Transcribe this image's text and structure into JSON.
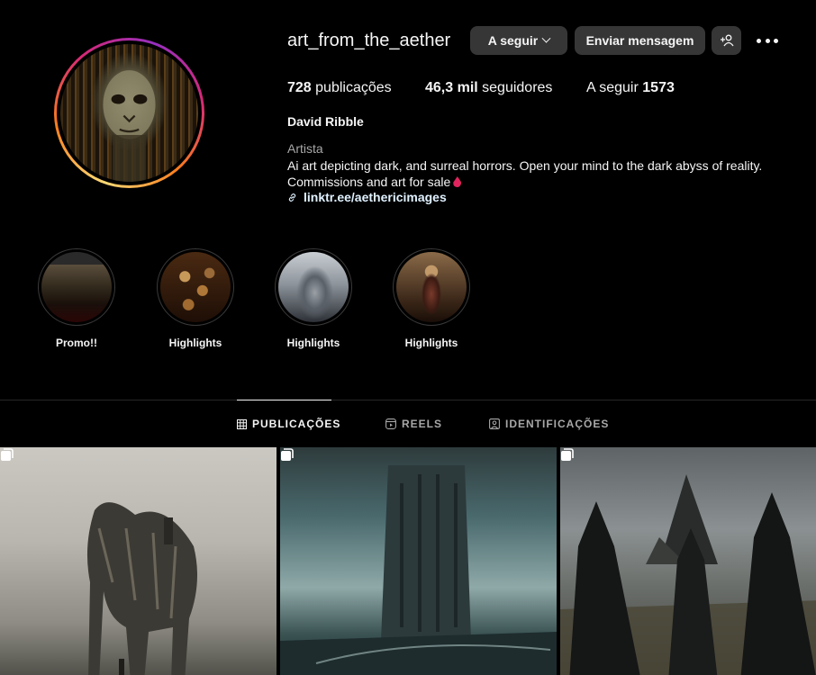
{
  "profile": {
    "username": "art_from_the_aether",
    "follow_button": "A seguir",
    "message_button": "Enviar mensagem",
    "stats": {
      "posts_count": "728",
      "posts_label": " publicações",
      "followers_count": "46,3 mil",
      "followers_label": " seguidores",
      "following_label": "A seguir ",
      "following_count": "1573"
    },
    "full_name": "David Ribble",
    "category": "Artista",
    "bio_line1": "Ai art depicting dark, and surreal horrors. Open your mind to the dark abyss of reality.",
    "bio_line2": "Commissions and art for sale",
    "link": "linktr.ee/aethericimages"
  },
  "highlights": [
    {
      "label": "Promo!!"
    },
    {
      "label": "Highlights"
    },
    {
      "label": "Highlights"
    },
    {
      "label": "Highlights"
    }
  ],
  "tabs": [
    {
      "label": "PUBLICAÇÕES",
      "icon": "grid-icon",
      "active": true
    },
    {
      "label": "REELS",
      "icon": "reels-icon",
      "active": false
    },
    {
      "label": "IDENTIFICAÇÕES",
      "icon": "tagged-icon",
      "active": false
    }
  ],
  "posts": [
    {
      "description_icon": "carousel-icon",
      "multiple": true
    },
    {
      "description_icon": "carousel-icon",
      "multiple": true
    },
    {
      "description_icon": "carousel-icon",
      "multiple": true
    }
  ],
  "colors": {
    "background": "#000000",
    "button": "#363636",
    "text": "#f5f5f5",
    "muted": "#a8a8a8",
    "link": "#e0f1ff",
    "ring_gradient": [
      "#feda75",
      "#fa7e1e",
      "#d62976",
      "#962fbf"
    ]
  }
}
